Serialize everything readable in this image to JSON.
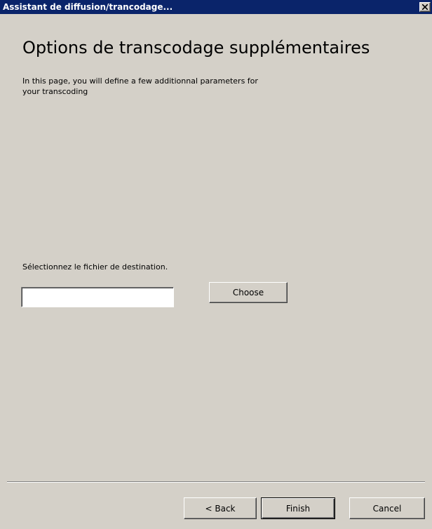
{
  "window": {
    "title": "Assistant de diffusion/trancodage..."
  },
  "page": {
    "heading": "Options de transcodage supplémentaires",
    "description": "In this page, you will define a few additionnal parameters for your transcoding"
  },
  "destination": {
    "label": "Sélectionnez le fichier de destination.",
    "value": "",
    "choose_label": "Choose"
  },
  "footer": {
    "back_label": "< Back",
    "finish_label": "Finish",
    "cancel_label": "Cancel"
  },
  "icons": {
    "close": "close-icon"
  },
  "colors": {
    "titlebar": "#0a246a",
    "window_bg": "#d4d0c8"
  }
}
